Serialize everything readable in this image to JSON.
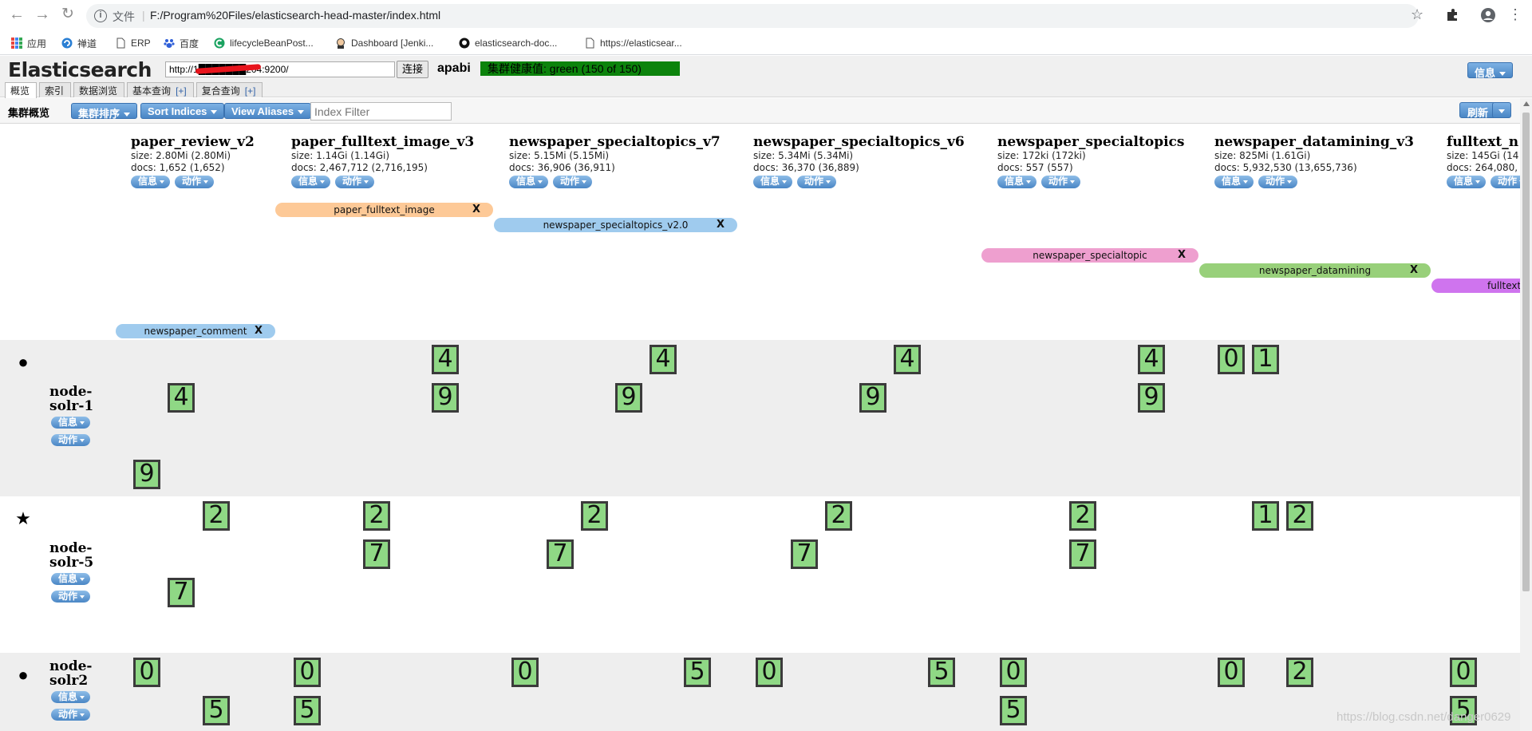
{
  "browser": {
    "scheme": "文件",
    "url": "F:/Program%20Files/elasticsearch-head-master/index.html",
    "bookmarks": [
      "应用",
      "禅道",
      "ERP",
      "百度",
      "lifecycleBeanPost...",
      "Dashboard [Jenki...",
      "elasticsearch-doc...",
      "https://elasticsear..."
    ]
  },
  "header": {
    "logo": "Elasticsearch",
    "url_value": "http://1███████204:9200/",
    "connect": "连接",
    "cluster_name": "apabi",
    "health": "集群健康值: green (150 of 150)",
    "info_btn": "信息",
    "tabs": [
      {
        "label": "概览",
        "plus": ""
      },
      {
        "label": "索引",
        "plus": ""
      },
      {
        "label": "数据浏览",
        "plus": ""
      },
      {
        "label": "基本查询",
        "plus": "[+]"
      },
      {
        "label": "复合查询",
        "plus": "[+]"
      }
    ]
  },
  "subbar": {
    "title": "集群概览",
    "sort_cluster": "集群排序",
    "sort_indices": "Sort Indices",
    "view_aliases": "View Aliases",
    "filter_placeholder": "Index Filter",
    "refresh": "刷新"
  },
  "btn": {
    "info": "信息",
    "action": "动作"
  },
  "indices": [
    {
      "name": "paper_review_v2",
      "size": "size: 2.80Mi (2.80Mi)",
      "docs": "docs: 1,652 (1,652)"
    },
    {
      "name": "paper_fulltext_image_v3",
      "size": "size: 1.14Gi (1.14Gi)",
      "docs": "docs: 2,467,712 (2,716,195)"
    },
    {
      "name": "newspaper_specialtopics_v7",
      "size": "size: 5.15Mi (5.15Mi)",
      "docs": "docs: 36,906 (36,911)"
    },
    {
      "name": "newspaper_specialtopics_v6",
      "size": "size: 5.34Mi (5.34Mi)",
      "docs": "docs: 36,370 (36,889)"
    },
    {
      "name": "newspaper_specialtopics",
      "size": "size: 172ki (172ki)",
      "docs": "docs: 557 (557)"
    },
    {
      "name": "newspaper_datamining_v3",
      "size": "size: 825Mi (1.61Gi)",
      "docs": "docs: 5,932,530 (13,655,736)"
    },
    {
      "name": "fulltext_n",
      "size": "size: 145Gi (14",
      "docs": "docs: 264,080,"
    }
  ],
  "aliases": [
    {
      "name": "paper_fulltext_image",
      "color": "#fdc997",
      "close": "X"
    },
    {
      "name": "newspaper_specialtopics_v2.0",
      "color": "#9fcbee",
      "close": "X"
    },
    {
      "name": "newspaper_specialtopic",
      "color": "#ee9fcf",
      "close": "X"
    },
    {
      "name": "newspaper_datamining",
      "color": "#98d07a",
      "close": "X"
    },
    {
      "name": "fulltext",
      "color": "#cf74ee",
      "close": ""
    },
    {
      "name": "newspaper_comment",
      "color": "#9fcbee",
      "close": "X"
    }
  ],
  "nodes": [
    {
      "name_line1": "node-",
      "name_line2": "solr-1",
      "icon": "master-node-icon",
      "icon_glyph": "●",
      "shards": [
        "4",
        "4",
        "4",
        "4",
        "0",
        "1",
        "4",
        "9",
        "9",
        "9",
        "9",
        "9"
      ]
    },
    {
      "name_line1": "node-",
      "name_line2": "solr-5",
      "icon": "elected-master-star-icon",
      "icon_glyph": "★",
      "shards": [
        "2",
        "2",
        "2",
        "2",
        "2",
        "1",
        "2",
        "7",
        "7",
        "7",
        "7",
        "7"
      ]
    },
    {
      "name_line1": "node-",
      "name_line2": "solr2",
      "icon": "master-node-icon",
      "icon_glyph": "●",
      "shards": [
        "0",
        "0",
        "0",
        "5",
        "0",
        "5",
        "0",
        "0",
        "2",
        "0",
        "5",
        "5",
        "5",
        "5"
      ]
    }
  ],
  "watermark": "https://blog.csdn.net/danger0629",
  "colors": {
    "health_green": "#0c830c",
    "shard_green": "#8fd885",
    "button_blue": "#4a86c5"
  }
}
